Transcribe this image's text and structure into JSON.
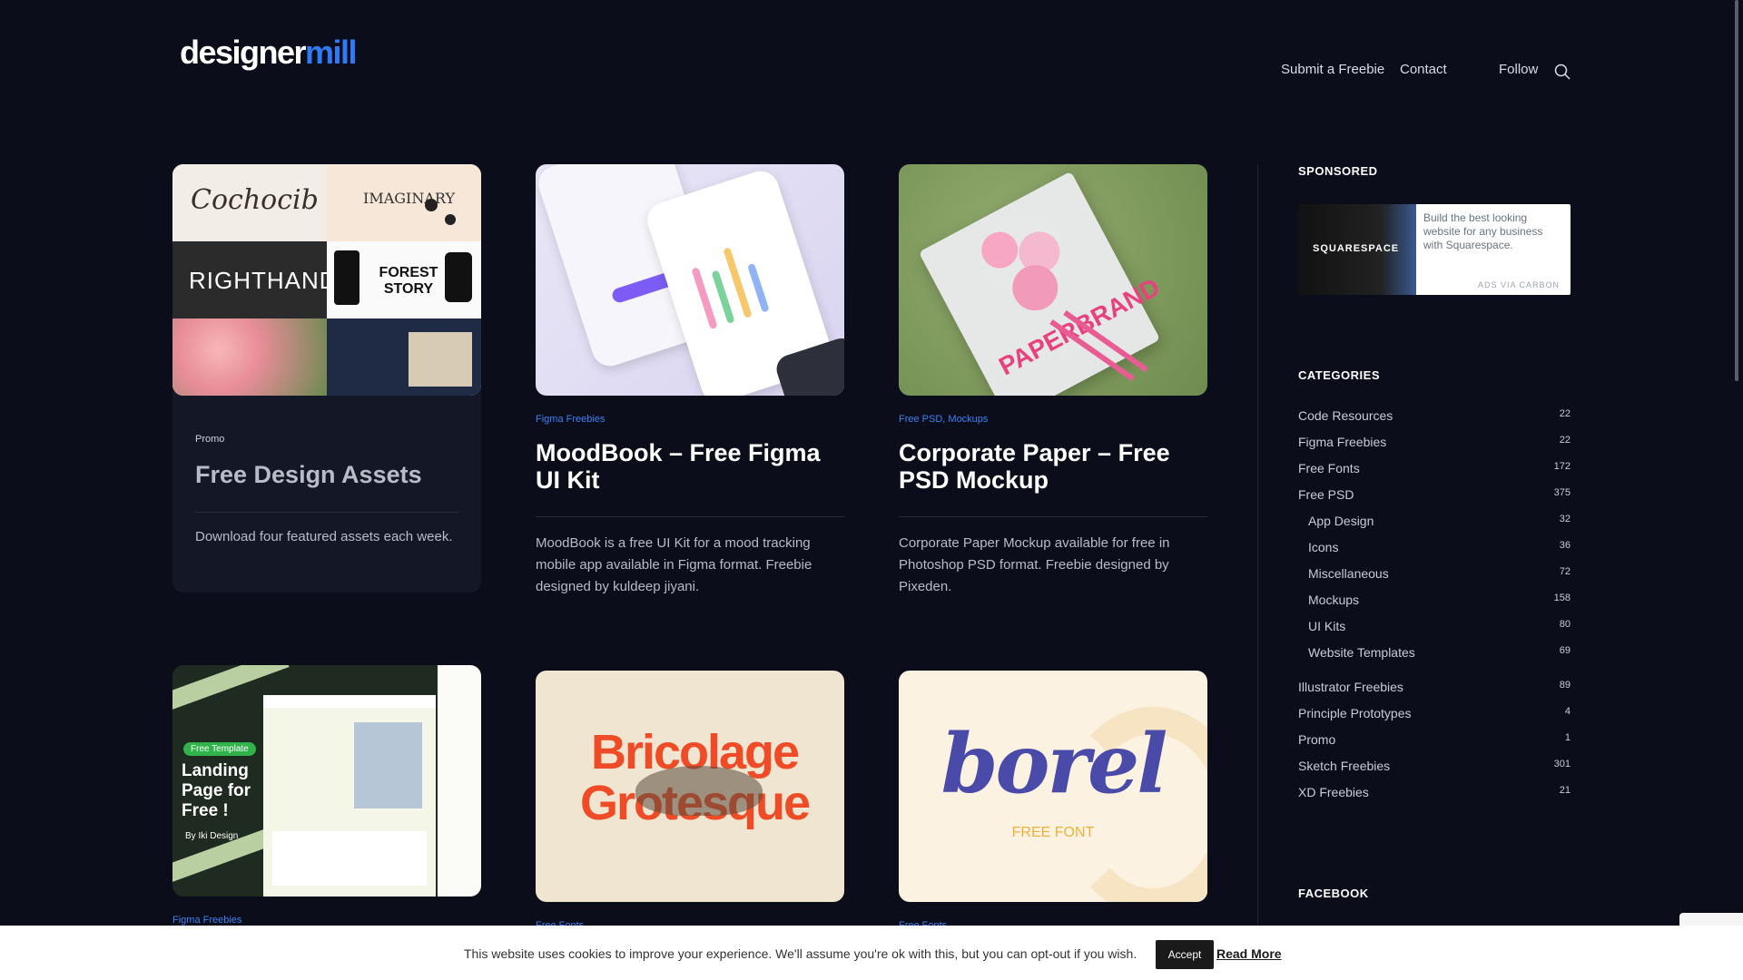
{
  "header": {
    "logo_main": "designer",
    "logo_accent": "mill",
    "nav": [
      "Submit a Freebie",
      "Contact",
      "Follow"
    ]
  },
  "cards": [
    {
      "category": "Promo",
      "title": "Free Design Assets",
      "description": "Download four featured assets each week.",
      "thumb_words": [
        "Cochocib",
        "IMAGINARY",
        "RIGHTHAND",
        "FOREST STORY"
      ]
    },
    {
      "category": "Figma Freebies",
      "title": "MoodBook – Free Figma UI Kit",
      "description": "MoodBook is a free UI Kit for a mood tracking mobile app available in Figma format. Freebie designed by kuldeep jiyani."
    },
    {
      "category": "Free PSD, Mockups",
      "title": "Corporate Paper – Free PSD Mockup",
      "description": "Corporate Paper Mockup available for free in Photoshop PSD format. Freebie designed by Pixeden.",
      "thumb_text": "PAPERBRAND"
    },
    {
      "category": "Figma Freebies",
      "thumb_tag": "Free Template",
      "thumb_text": "Landing Page for Free !",
      "thumb_by": "By Iki Design"
    },
    {
      "category": "Free Fonts",
      "thumb_text": "Bricolage Grotesque"
    },
    {
      "category": "Free Fonts",
      "thumb_text": "borel",
      "thumb_sub": "FREE FONT"
    }
  ],
  "sidebar": {
    "sponsored_heading": "SPONSORED",
    "ad_brand": "SQUARESPACE",
    "ad_text": "Build the best looking website for any business with Squarespace.",
    "ad_via": "ADS VIA CARBON",
    "categories_heading": "CATEGORIES",
    "categories": [
      {
        "label": "Code Resources",
        "count": "22"
      },
      {
        "label": "Figma Freebies",
        "count": "22"
      },
      {
        "label": "Free Fonts",
        "count": "172"
      },
      {
        "label": "Free PSD",
        "count": "375"
      },
      {
        "label": "App Design",
        "count": "32",
        "sub": true
      },
      {
        "label": "Icons",
        "count": "36",
        "sub": true
      },
      {
        "label": "Miscellaneous",
        "count": "72",
        "sub": true
      },
      {
        "label": "Mockups",
        "count": "158",
        "sub": true
      },
      {
        "label": "UI Kits",
        "count": "80",
        "sub": true
      },
      {
        "label": "Website Templates",
        "count": "69",
        "sub": true
      },
      {
        "label": "Illustrator Freebies",
        "count": "89"
      },
      {
        "label": "Principle Prototypes",
        "count": "4"
      },
      {
        "label": "Promo",
        "count": "1"
      },
      {
        "label": "Sketch Freebies",
        "count": "301"
      },
      {
        "label": "XD Freebies",
        "count": "21"
      }
    ],
    "facebook_heading": "FACEBOOK"
  },
  "cookie": {
    "text": "This website uses cookies to improve your experience. We'll assume you're ok with this, but you can opt-out if you wish.",
    "accept": "Accept",
    "read_more": "Read More"
  }
}
